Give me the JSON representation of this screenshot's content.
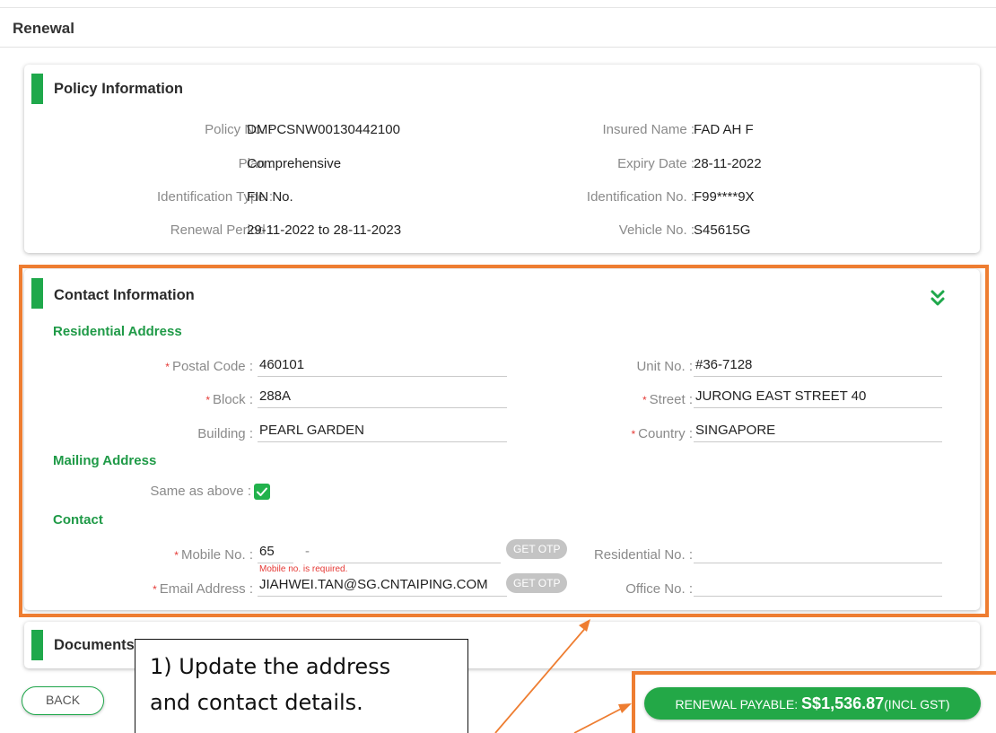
{
  "page": {
    "title": "Renewal"
  },
  "policy": {
    "title": "Policy Information",
    "fields": [
      {
        "label": "Policy No. :",
        "value": "DMPCSNW00130442100"
      },
      {
        "label": "Insured Name :",
        "value": "FAD AH F"
      },
      {
        "label": "Plan :",
        "value": "Comprehensive"
      },
      {
        "label": "Expiry Date :",
        "value": "28-11-2022"
      },
      {
        "label": "Identification Type :",
        "value": "FIN No."
      },
      {
        "label": "Identification No. :",
        "value": "F99****9X"
      },
      {
        "label": "Renewal Period :",
        "value": "29-11-2022 to 28-11-2023"
      },
      {
        "label": "Vehicle No. :",
        "value": "S45615G"
      }
    ]
  },
  "contact": {
    "title": "Contact Information",
    "residential_heading": "Residential Address",
    "postal_label": "Postal Code :",
    "postal_value": "460101",
    "unit_label": "Unit No. :",
    "unit_value": "#36-7128",
    "block_label": "Block :",
    "block_value": "288A",
    "street_label": "Street :",
    "street_value": "JURONG EAST STREET 40",
    "building_label": "Building :",
    "building_value": "PEARL GARDEN",
    "country_label": "Country :",
    "country_value": "SINGAPORE",
    "mailing_heading": "Mailing Address",
    "same_label": "Same as above :",
    "same_checked": true,
    "contact_heading": "Contact",
    "mobile_label": "Mobile No. :",
    "mobile_code": "65",
    "mobile_dash": "-",
    "mobile_value": "",
    "mobile_error": "Mobile no. is required.",
    "otp_label": "GET OTP",
    "residential_no_label": "Residential No. :",
    "residential_no_value": "",
    "email_label": "Email Address :",
    "email_value": "JIAHWEI.TAN@SG.CNTAIPING.COM",
    "office_label": "Office No. :",
    "office_value": ""
  },
  "documents": {
    "title": "Documents"
  },
  "actions": {
    "back_label": "BACK",
    "payable_prefix": "RENEWAL PAYABLE: ",
    "payable_amount": "S$1,536.87",
    "payable_suffix": "(INCL GST)"
  },
  "annotation": {
    "line1": "1) Update the address",
    "line2": "and contact details."
  },
  "colors": {
    "accent": "#1fa84b",
    "annotation": "#ee7d31",
    "required": "#e53935"
  }
}
